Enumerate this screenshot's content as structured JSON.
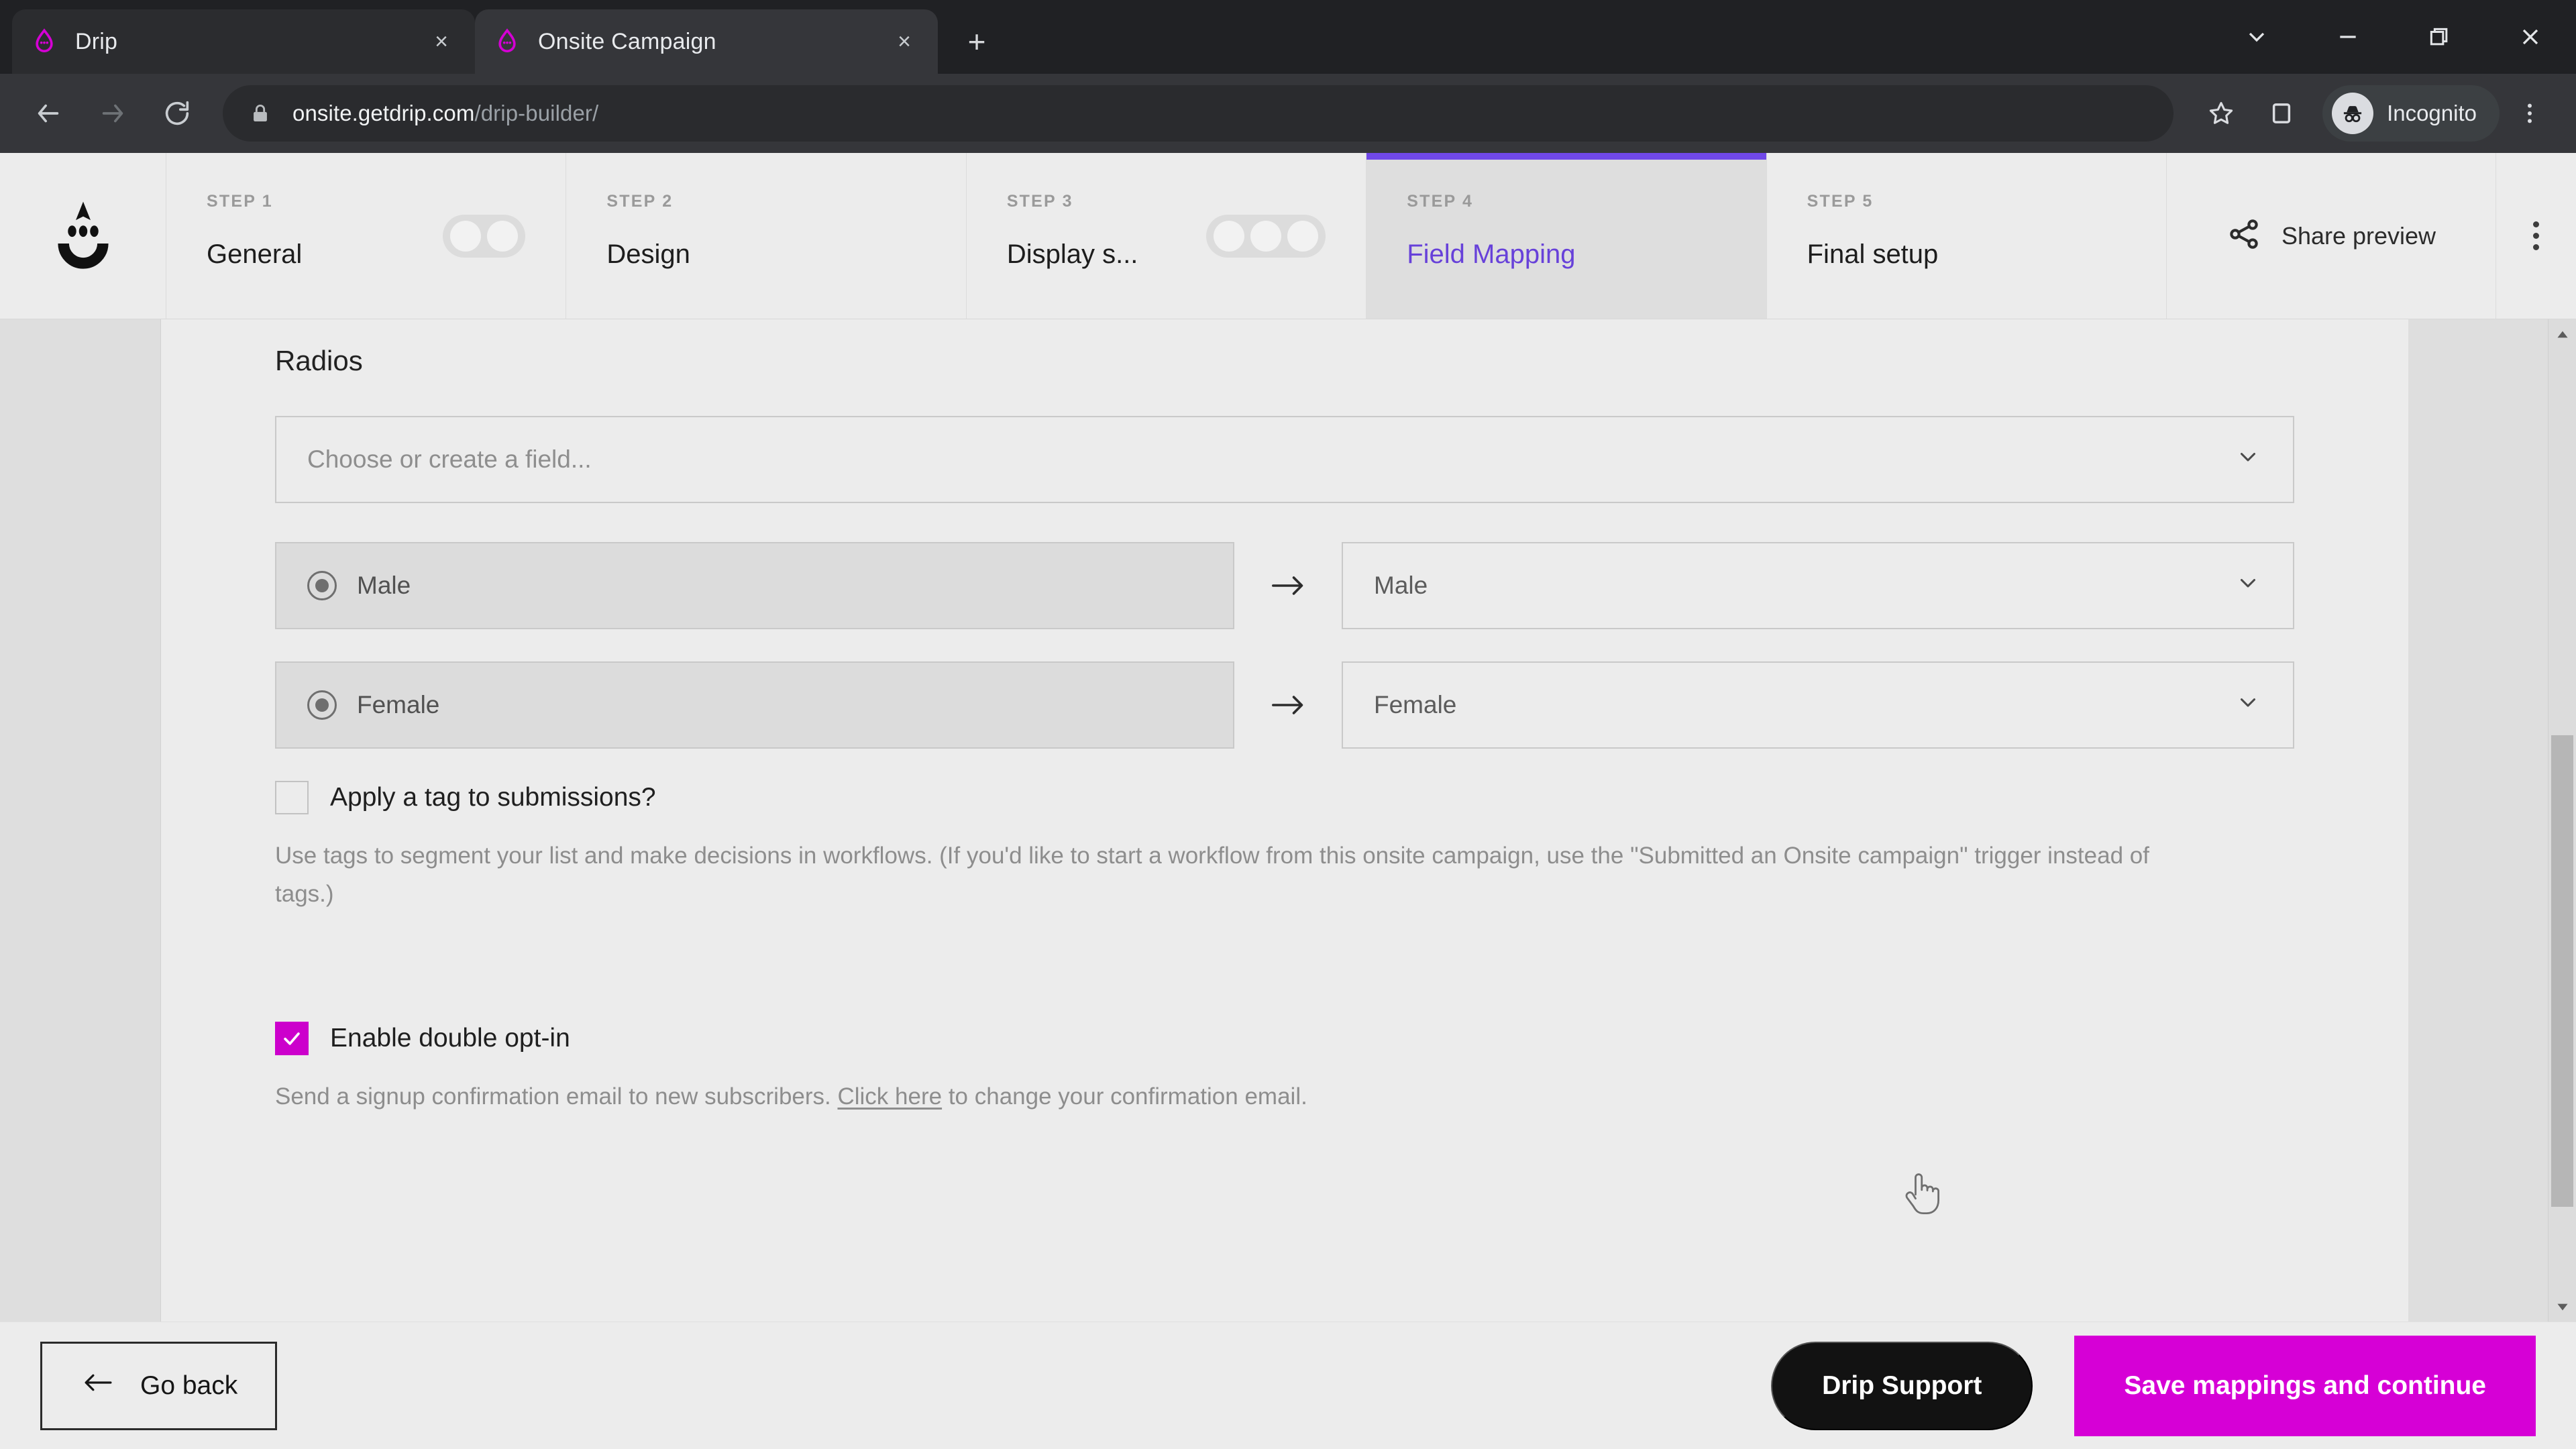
{
  "browser": {
    "tabs": [
      {
        "title": "Drip",
        "favicon": "drip-logo-icon",
        "active": false
      },
      {
        "title": "Onsite Campaign",
        "favicon": "drip-logo-icon",
        "active": true
      }
    ],
    "new_tab_label": "+",
    "close_label": "×",
    "window_controls": {
      "tab_search": "tab-search-icon",
      "minimize": "minimize-icon",
      "maximize": "maximize-icon",
      "close": "close-icon"
    },
    "toolbar": {
      "back": "back-arrow-icon",
      "forward": "forward-arrow-icon",
      "reload": "reload-icon",
      "lock": "lock-icon",
      "url_host": "onsite.getdrip.com",
      "url_path": "/drip-builder/",
      "bookmark": "star-icon",
      "side_panel": "side-panel-icon",
      "incognito_label": "Incognito",
      "menu": "kebab-menu-icon"
    }
  },
  "app": {
    "logo": "drip-face-logo-icon",
    "steps": [
      {
        "num": "STEP 1",
        "name": "General",
        "active": false,
        "pill_dots": 2
      },
      {
        "num": "STEP 2",
        "name": "Design",
        "active": false,
        "pill_dots": 0
      },
      {
        "num": "STEP 3",
        "name": "Display s...",
        "active": false,
        "pill_dots": 3
      },
      {
        "num": "STEP 4",
        "name": "Field Mapping",
        "active": true,
        "pill_dots": 0
      },
      {
        "num": "STEP 5",
        "name": "Final setup",
        "active": false,
        "pill_dots": 0
      }
    ],
    "share_preview_label": "Share preview",
    "share_icon": "share-icon",
    "overflow_icon": "kebab-menu-icon",
    "accent_purple": "#6741d9"
  },
  "main": {
    "section_title": "Radios",
    "field_picker": {
      "placeholder": "Choose or create a field...",
      "chevron": "chevron-down-icon"
    },
    "mappings": [
      {
        "source_label": "Male",
        "target_value": "Male",
        "radio": "radio-selected-icon",
        "arrow": "arrow-right-icon",
        "chevron": "chevron-down-icon"
      },
      {
        "source_label": "Female",
        "target_value": "Female",
        "radio": "radio-selected-icon",
        "arrow": "arrow-right-icon",
        "chevron": "chevron-down-icon"
      }
    ],
    "tag_checkbox": {
      "label": "Apply a tag to submissions?",
      "checked": false
    },
    "tag_help_line1": "Use tags to segment your list and make decisions in workflows. (If you'd like to start a workflow from this onsite campaign, use the",
    "tag_help_line2": "\"Submitted an Onsite campaign\" trigger instead of tags.)",
    "optin_checkbox": {
      "label": "Enable double opt-in",
      "checked": true,
      "check_glyph": "✓",
      "color": "#cc00cc"
    },
    "optin_help_pre": "Send a signup confirmation email to new subscribers. ",
    "optin_help_link": "Click here",
    "optin_help_post": " to change your confirmation email."
  },
  "footer": {
    "go_back_label": "Go back",
    "go_back_icon": "arrow-left-icon",
    "support_label": "Drip Support",
    "save_label": "Save mappings and continue",
    "save_color": "#d600d6"
  },
  "scrollbar": {
    "up_icon": "scroll-up-arrow-icon",
    "down_icon": "scroll-down-arrow-icon",
    "thumb": "scrollbar-thumb"
  },
  "cursor": "pointer-hand-cursor"
}
